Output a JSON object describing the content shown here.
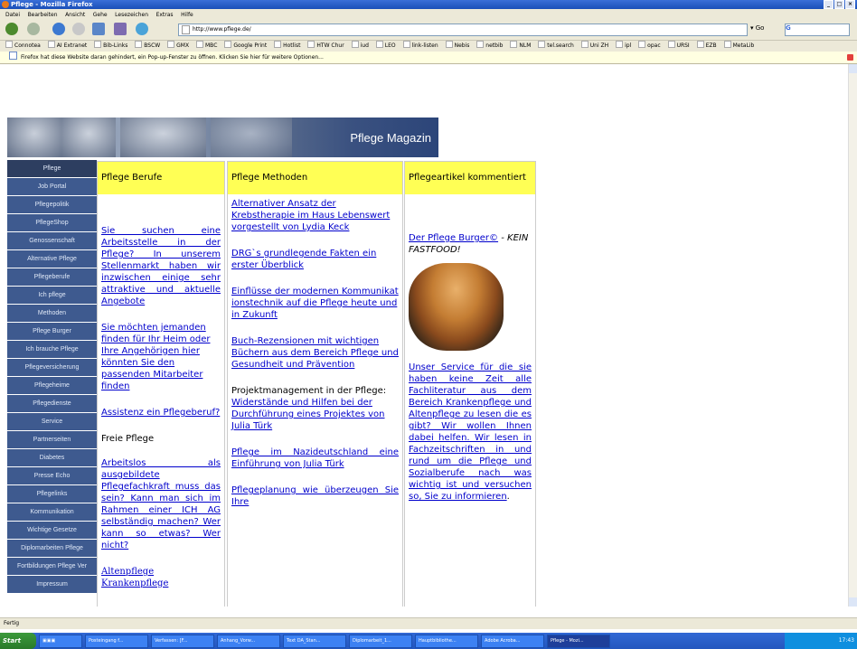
{
  "window": {
    "title": "Pflege - Mozilla Firefox",
    "min": "_",
    "max": "□",
    "close": "×"
  },
  "menu": [
    "Datei",
    "Bearbeiten",
    "Ansicht",
    "Gehe",
    "Lesezeichen",
    "Extras",
    "Hilfe"
  ],
  "nav": {
    "url": "http://www.pflege.de/",
    "go_label": "Go",
    "search_icon": "G"
  },
  "bookmarks": [
    "Connotea",
    "AI Extranet",
    "Bib-Links",
    "BSCW",
    "GMX",
    "MBC",
    "Google Print",
    "Hotlist",
    "HTW Chur",
    "iud",
    "LEO",
    "link-listen",
    "Nebis",
    "netbib",
    "NLM",
    "tel.search",
    "Uni ZH",
    "ipl",
    "opac",
    "URSI",
    "EZB",
    "MetaLib"
  ],
  "popup_notice": "Firefox hat diese Website daran gehindert, ein Pop-up-Fenster zu öffnen. Klicken Sie hier für weitere Optionen...",
  "banner": {
    "title": "Pflege Magazin"
  },
  "sidebar": [
    "Pflege",
    "Job Portal",
    "Pflegepolitik",
    "PflegeShop",
    "Genossenschaft",
    "Alternative Pflege",
    "Pflegeberufe",
    "Ich pflege",
    "Methoden",
    "Pflege Burger",
    "Ich brauche Pflege",
    "Pflegeversicherung",
    "Pflegeheime",
    "Pflegedienste",
    "Service",
    "Partnerseiten",
    "Diabetes",
    "Presse Echo",
    "Pflegelinks",
    "Kommunikation",
    "Wichtige Gesetze",
    "Diplomarbeiten Pflege",
    "Fortbildungen Pflege Ver",
    "Impressum"
  ],
  "col1": {
    "header": "Pflege Berufe",
    "link1": "Sie suchen eine Arbeitsstelle in der Pflege? In unserem Stellenmarkt haben wir inzwischen einige sehr attraktive und aktuelle Angebote",
    "link2": "Sie möchten jemanden finden für Ihr Heim oder Ihre Angehörigen hier könnten Sie den passenden Mitarbeiter finden",
    "link3": "Assistenz ein Pflegeberuf?",
    "subhead": "Freie Pflege",
    "link4": "Arbeitslos als ausgebildete Pflegefachkraft muss das sein? Kann man sich im Rahmen einer ICH AG selbständig machen? Wer kann so etwas? Wer nicht?",
    "link5": "Altenpflege Krankenpflege"
  },
  "col2": {
    "header": "Pflege Methoden",
    "link1": "Alternativer Ansatz der Krebstherapie im Haus Lebenswert vorgestellt von Lydia Keck",
    "link2": "DRG`s grundlegende Fakten ein erster Überblick",
    "link3": "Einflüsse der modernen Kommunikationstechnik auf die Pflege heute und in Zukunft",
    "link4": "Buch-Rezensionen mit wichtigen Büchern aus dem Bereich Pflege und Gesundheit und Prävention",
    "text5": "Projektmanagement in der Pflege: ",
    "link5": "Widerstände und Hilfen bei der Durchführung eines Projektes von Julia Türk",
    "link6": "Pflege im Nazideutschland eine Einführung von Julia Türk",
    "link7": "Pflegeplanung wie überzeugen Sie Ihre"
  },
  "col3": {
    "header": "Pflegeartikel kommentiert",
    "link1": "Der Pflege Burger©",
    "tag": " - KEIN FASTFOOD!",
    "link2": "Unser Service für die sie haben keine Zeit alle Fachliteratur aus dem Bereich Krankenpflege und Altenpflege zu lesen die es gibt? Wir wollen Ihnen dabei helfen. Wir lesen in Fachzeitschriften in und rund um die Pflege und Sozialberufe nach was wichtig ist und versuchen so, Sie zu informieren",
    "period": "."
  },
  "status": "Fertig",
  "taskbar": {
    "start": "Start",
    "items": [
      "Posteingang f...",
      "Verfassen: [F...",
      "Anhang_Vorw...",
      "Text DA_Stan...",
      "Diplomarbeit_1...",
      "Hauptbibliothe...",
      "Adobe Acroba...",
      "Pflege - Mozi..."
    ],
    "clock": "17:43"
  }
}
